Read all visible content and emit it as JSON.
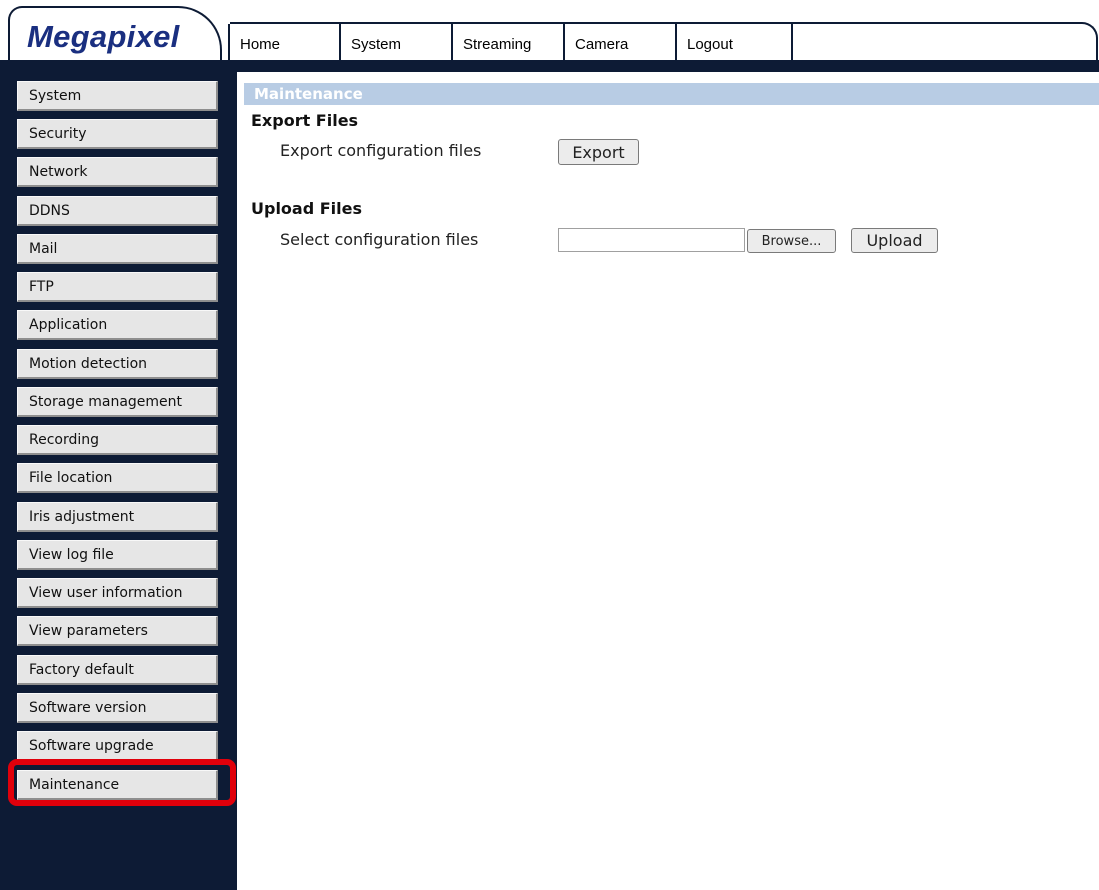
{
  "header": {
    "logo": "Megapixel",
    "tabs": [
      {
        "label": "Home"
      },
      {
        "label": "System"
      },
      {
        "label": "Streaming"
      },
      {
        "label": "Camera"
      },
      {
        "label": "Logout"
      }
    ]
  },
  "sidebar": {
    "items": [
      {
        "label": "System"
      },
      {
        "label": "Security"
      },
      {
        "label": "Network"
      },
      {
        "label": "DDNS"
      },
      {
        "label": "Mail"
      },
      {
        "label": "FTP"
      },
      {
        "label": "Application"
      },
      {
        "label": "Motion detection"
      },
      {
        "label": "Storage management"
      },
      {
        "label": "Recording"
      },
      {
        "label": "File location"
      },
      {
        "label": "Iris adjustment"
      },
      {
        "label": "View log file"
      },
      {
        "label": "View user information"
      },
      {
        "label": "View parameters"
      },
      {
        "label": "Factory default"
      },
      {
        "label": "Software version"
      },
      {
        "label": "Software upgrade"
      },
      {
        "label": "Maintenance"
      }
    ],
    "highlight_color": "#e0000b"
  },
  "main": {
    "section_title": "Maintenance",
    "export": {
      "heading": "Export Files",
      "label": "Export configuration files",
      "button": "Export"
    },
    "upload": {
      "heading": "Upload Files",
      "label": "Select configuration files",
      "file_value": "",
      "browse_button": "Browse...",
      "upload_button": "Upload"
    }
  },
  "colors": {
    "navy": "#0d1b35",
    "logo_blue": "#1a2f80",
    "section_bar": "#b8cce4",
    "highlight": "#e0000b"
  }
}
